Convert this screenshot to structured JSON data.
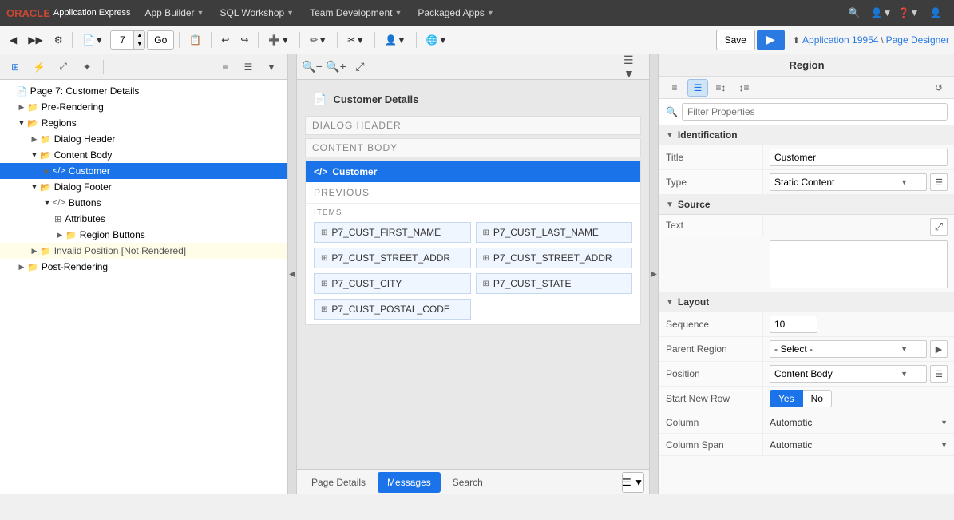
{
  "app": {
    "oracle_text": "ORACLE",
    "app_express_text": "Application Express",
    "nav_items": [
      {
        "label": "App Builder",
        "id": "app-builder"
      },
      {
        "label": "SQL Workshop",
        "id": "sql-workshop"
      },
      {
        "label": "Team Development",
        "id": "team-development"
      },
      {
        "label": "Packaged Apps",
        "id": "packaged-apps"
      }
    ],
    "app_info": "Application 19954",
    "page_designer": "Page Designer",
    "page_number": "7",
    "save_label": "Save",
    "run_icon": "▶"
  },
  "toolbar2": {
    "go_label": "Go",
    "page_num": "7"
  },
  "left_panel": {
    "page_label": "Page 7: Customer Details",
    "tree": [
      {
        "id": "pre-rendering",
        "label": "Pre-Rendering",
        "indent": 1,
        "type": "folder",
        "open": false
      },
      {
        "id": "regions",
        "label": "Regions",
        "indent": 1,
        "type": "folder",
        "open": true
      },
      {
        "id": "dialog-header",
        "label": "Dialog Header",
        "indent": 2,
        "type": "folder",
        "open": false
      },
      {
        "id": "content-body",
        "label": "Content Body",
        "indent": 2,
        "type": "folder",
        "open": true
      },
      {
        "id": "customer",
        "label": "Customer",
        "indent": 3,
        "type": "code",
        "open": false,
        "selected": true
      },
      {
        "id": "dialog-footer",
        "label": "Dialog Footer",
        "indent": 2,
        "type": "folder",
        "open": true
      },
      {
        "id": "buttons",
        "label": "Buttons",
        "indent": 3,
        "type": "code",
        "open": true
      },
      {
        "id": "attributes",
        "label": "Attributes",
        "indent": 4,
        "type": "grid",
        "open": false
      },
      {
        "id": "region-buttons",
        "label": "Region Buttons",
        "indent": 4,
        "type": "folder",
        "open": false
      },
      {
        "id": "invalid-position",
        "label": "Invalid Position [Not Rendered]",
        "indent": 2,
        "type": "folder",
        "open": false,
        "special": "invalid"
      },
      {
        "id": "post-rendering",
        "label": "Post-Rendering",
        "indent": 1,
        "type": "folder",
        "open": false
      }
    ]
  },
  "center_panel": {
    "page_title": "Customer Details",
    "dialog_header_label": "DIALOG HEADER",
    "content_body_label": "CONTENT BODY",
    "customer_region_label": "Customer",
    "previous_label": "PREVIOUS",
    "items_label": "ITEMS",
    "items": [
      "P7_CUST_FIRST_NAME",
      "P7_CUST_LAST_NAME",
      "P7_CUST_STREET_ADDR",
      "P7_CUST_STREET_ADDR",
      "P7_CUST_CITY",
      "P7_CUST_STATE",
      "P7_CUST_POSTAL_CODE",
      ""
    ],
    "tabs": [
      {
        "label": "Page Details",
        "id": "page-details"
      },
      {
        "label": "Messages",
        "id": "messages",
        "active": true
      },
      {
        "label": "Search",
        "id": "search"
      }
    ]
  },
  "right_panel": {
    "title": "Region",
    "filter_placeholder": "Filter Properties",
    "sections": {
      "identification": "Identification",
      "source": "Source",
      "layout": "Layout"
    },
    "props": {
      "title_label": "Title",
      "title_value": "Customer",
      "type_label": "Type",
      "type_value": "Static Content",
      "text_label": "Text",
      "sequence_label": "Sequence",
      "sequence_value": "10",
      "parent_region_label": "Parent Region",
      "parent_region_value": "- Select -",
      "position_label": "Position",
      "position_value": "Content Body",
      "start_new_row_label": "Start New Row",
      "yes_label": "Yes",
      "no_label": "No",
      "column_label": "Column",
      "column_value": "Automatic",
      "column_span_label": "Column Span",
      "column_span_value": "Automatic"
    }
  }
}
